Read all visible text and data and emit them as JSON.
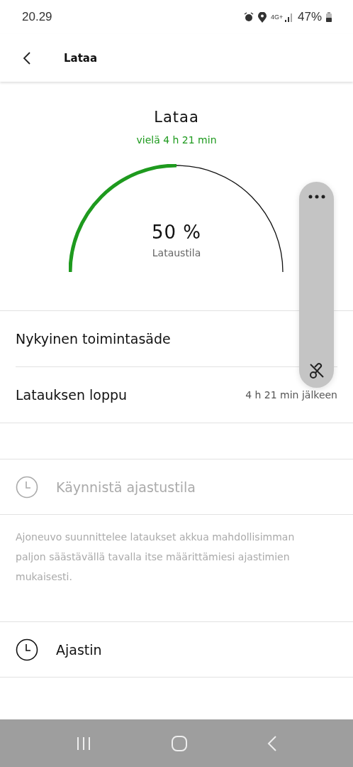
{
  "status_bar": {
    "time": "20.29",
    "network": "4G+",
    "battery": "47%"
  },
  "header": {
    "title": "Lataa"
  },
  "charge": {
    "title": "Lataa",
    "remaining": "vielä 4 h 21 min",
    "percent": "50 %",
    "caption": "Lataustila"
  },
  "info_rows": [
    {
      "label": "Nykyinen toimintasäde"
    },
    {
      "label": "Latauksen loppu",
      "value": "4 h 21 min jälkeen"
    }
  ],
  "timer_mode": {
    "label": "Käynnistä ajastustila",
    "disabled": true,
    "description": "Ajoneuvo suunnittelee lataukset akkua mahdollisimman paljon säästävällä tavalla itse määrittämiesi ajastimien mukaisesti."
  },
  "timer": {
    "label": "Ajastin",
    "disabled": false
  }
}
